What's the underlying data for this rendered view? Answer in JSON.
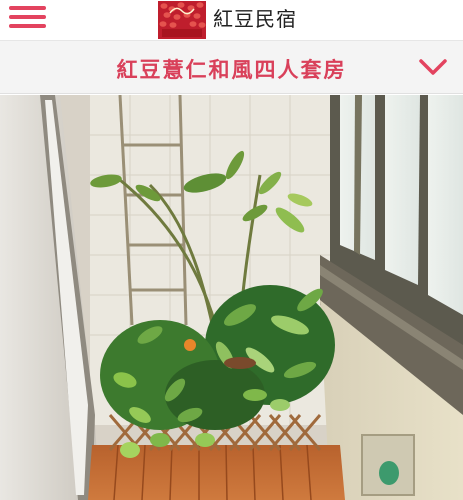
{
  "header": {
    "brand_name": "紅豆民宿",
    "menu_icon": "hamburger-menu-icon",
    "logo_icon": "red-bean-logo",
    "accent_color": "#e3435f"
  },
  "room": {
    "title": "紅豆薏仁和風四人套房",
    "dropdown_icon": "chevron-down-icon",
    "title_color": "#d9405a"
  },
  "photo": {
    "icon": "balcony-garden-photo"
  }
}
